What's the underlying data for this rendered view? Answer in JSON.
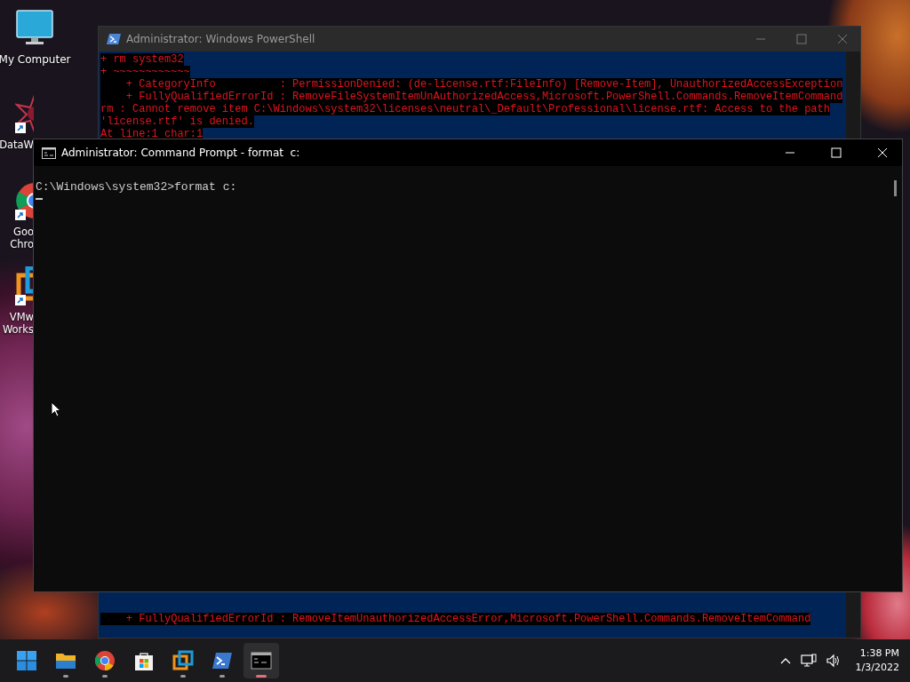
{
  "desktop": {
    "icons": [
      {
        "kind": "monitor",
        "label_lines": [
          "My Computer"
        ],
        "shortcut": false
      },
      {
        "kind": "star",
        "label_lines": [
          "DataW"
        ],
        "shortcut": true
      },
      {
        "kind": "browser",
        "label_lines": [
          "Goo",
          "Chro"
        ],
        "shortcut": true
      },
      {
        "kind": "vm",
        "label_lines": [
          "VMw",
          "Works"
        ],
        "shortcut": true
      }
    ]
  },
  "powershell": {
    "title": "Administrator: Windows PowerShell",
    "lines_top": [
      "+ rm system32",
      "+ ~~~~~~~~~~~~",
      "    + CategoryInfo          : PermissionDenied: (de-license.rtf:FileInfo) [Remove-Item], UnauthorizedAccessException",
      "    + FullyQualifiedErrorId : RemoveFileSystemItemUnAuthorizedAccess,Microsoft.PowerShell.Commands.RemoveItemCommand",
      "rm : Cannot remove item C:\\Windows\\system32\\licenses\\neutral\\_Default\\Professional\\license.rtf: Access to the path",
      "'license.rtf' is denied.",
      "At line:1 char:1"
    ],
    "lines_bottom": [
      "    + FullyQualifiedErrorId : RemoveItemUnauthorizedAccessError,Microsoft.PowerShell.Commands.RemoveItemCommand"
    ]
  },
  "cmd": {
    "title": "Administrator: Command Prompt - format  c:",
    "lines": [
      "C:\\Windows\\system32>format c:"
    ]
  },
  "taskbar": {
    "apps": [
      {
        "kind": "start",
        "running": false,
        "selected": false
      },
      {
        "kind": "explorer",
        "running": true,
        "selected": false
      },
      {
        "kind": "chrome",
        "running": true,
        "selected": false
      },
      {
        "kind": "store",
        "running": false,
        "selected": false
      },
      {
        "kind": "vmware",
        "running": true,
        "selected": false
      },
      {
        "kind": "powershell",
        "running": true,
        "selected": false
      },
      {
        "kind": "cmd",
        "running": true,
        "selected": true
      }
    ],
    "clock": {
      "time": "1:38 PM",
      "date": "1/3/2022"
    }
  }
}
